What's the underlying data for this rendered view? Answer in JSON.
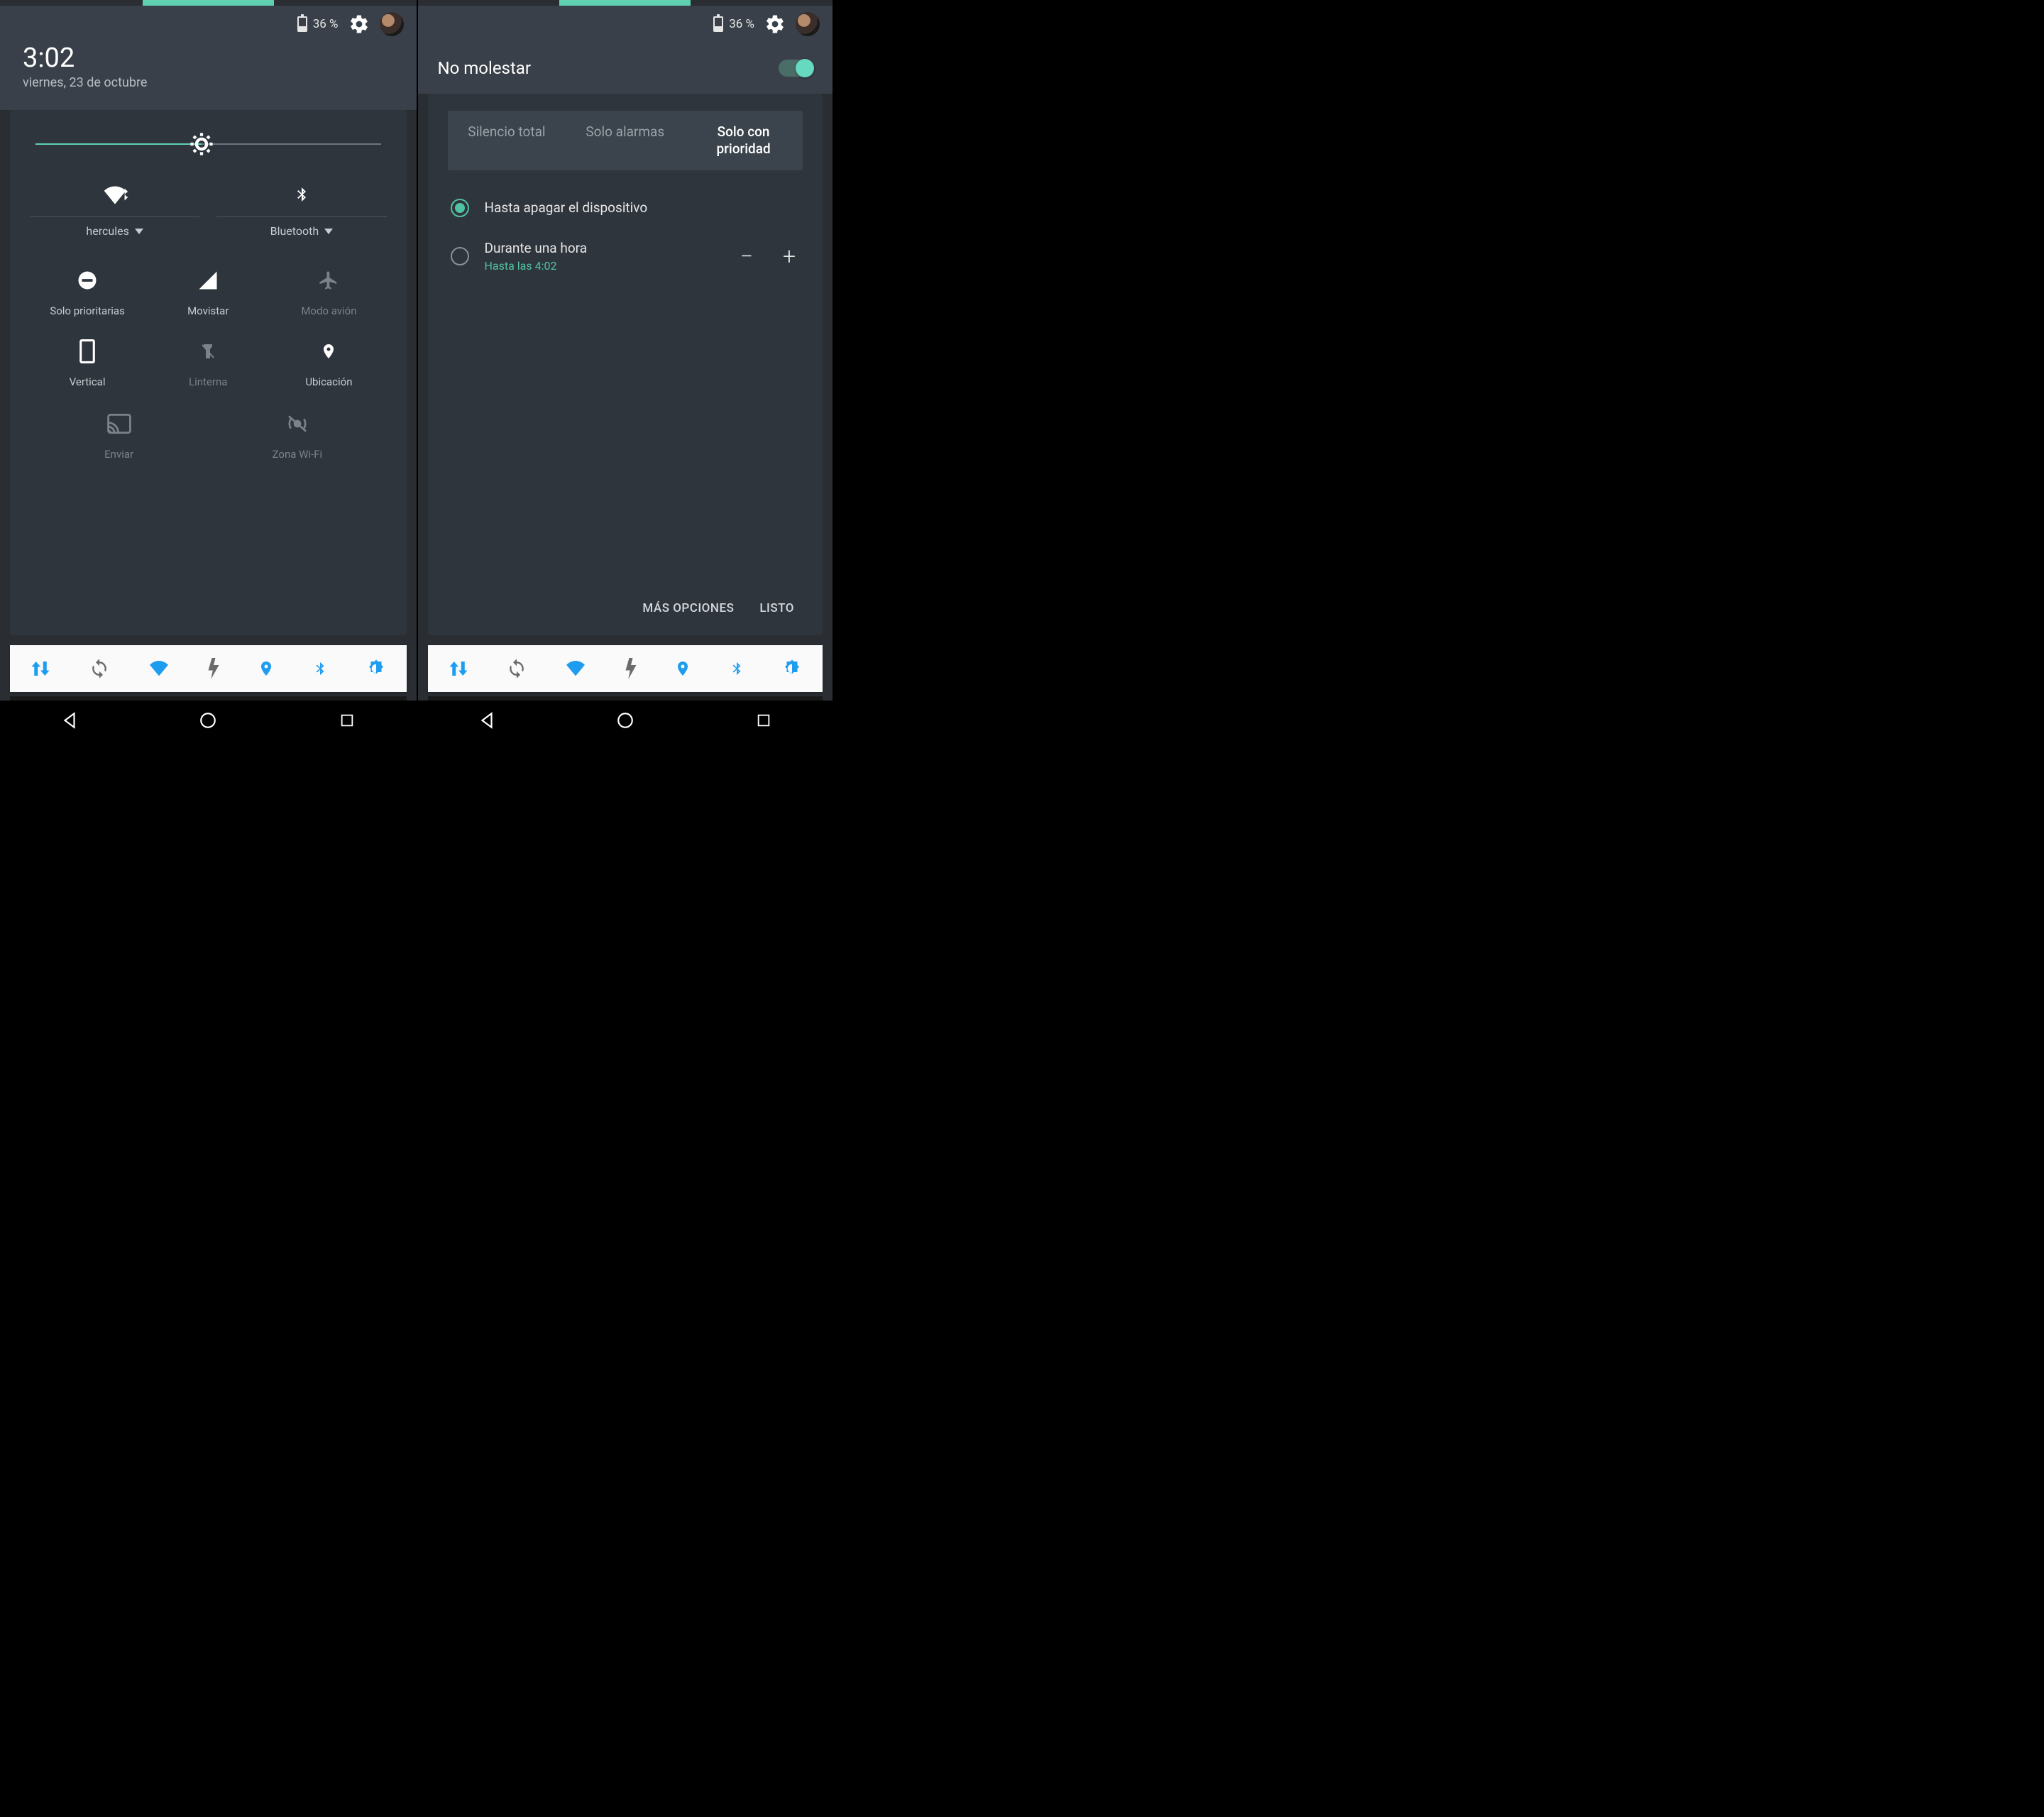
{
  "status": {
    "battery": "36 %",
    "battery_fill_pct": 36
  },
  "left": {
    "time": "3:02",
    "date": "viernes, 23 de octubre",
    "brightness_pct": 48,
    "wifi_label": "hercules",
    "bt_label": "Bluetooth",
    "tiles": {
      "dnd": "Solo prioritarias",
      "signal": "Movistar",
      "airplane": "Modo avión",
      "rotation": "Vertical",
      "flashlight": "Linterna",
      "location": "Ubicación",
      "cast": "Enviar",
      "hotspot": "Zona Wi-Fi"
    }
  },
  "right": {
    "title": "No molestar",
    "toggle_on": true,
    "segments": {
      "total": "Silencio total",
      "alarms": "Solo alarmas",
      "priority": "Solo con prioridad"
    },
    "opt1": "Hasta apagar el dispositivo",
    "opt2_label": "Durante una hora",
    "opt2_sub": "Hasta las 4:02",
    "btn_more": "MÁS OPCIONES",
    "btn_done": "LISTO"
  },
  "colors": {
    "accent": "#5fd1b0",
    "blue": "#1e9df0"
  }
}
